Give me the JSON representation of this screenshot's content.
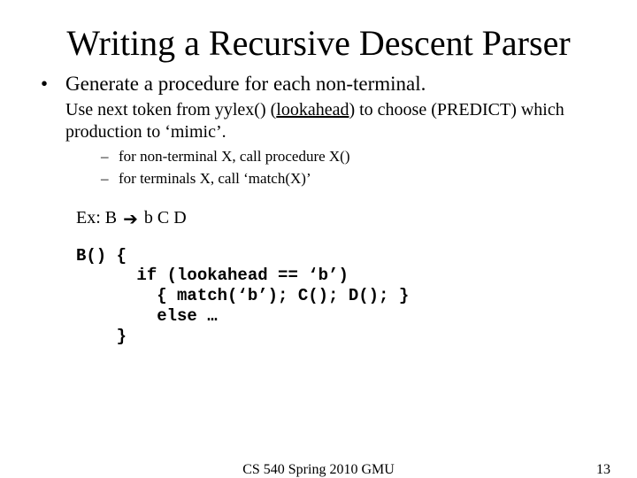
{
  "title": "Writing a Recursive Descent Parser",
  "bullet1": "Generate a procedure for each non-terminal.",
  "sub1_pre": "Use next token from yylex() (",
  "sub1_underlined": "lookahead",
  "sub1_post": ") to choose (PREDICT) which production to ‘mimic’.",
  "dash1": "for non-terminal X, call procedure X()",
  "dash2": "for terminals X, call ‘match(X)’",
  "ex_prefix": "Ex:  B ",
  "ex_suffix": " b C D",
  "code": "B() {\n      if (lookahead == ‘b’)\n        { match(‘b’); C(); D(); }\n        else …\n    }",
  "footer_center": "CS 540 Spring 2010 GMU",
  "footer_right": "13"
}
